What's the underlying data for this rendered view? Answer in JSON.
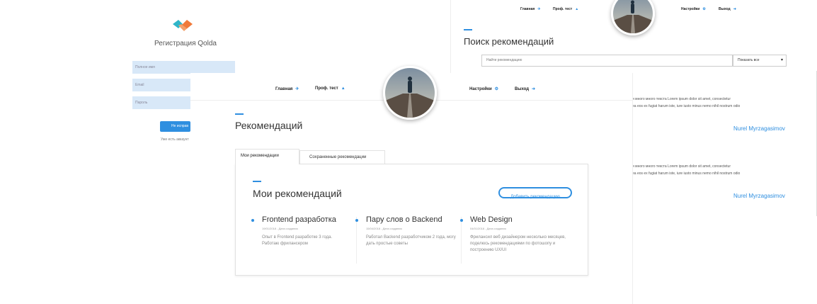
{
  "registration": {
    "title": "Регистрация Qolda",
    "fields": [
      "Полное имя",
      "Email",
      "Пароль"
    ],
    "submit_label": "Не исправ",
    "footer_text": "Уже есть аккаунт"
  },
  "search_window": {
    "nav": {
      "home": "Главная",
      "test": "Проф. тест",
      "settings": "Настройки",
      "logout": "Выход"
    },
    "title": "Поиск рекомендаций",
    "search_placeholder": "Найти рекомендацию",
    "filter_value": "Показать все",
    "results": [
      {
        "line1": "и много много текста Lorem ipsum dolor sit amet, consectetur",
        "line2": "ea eos ex fugiat harum iste, iure iusto minus nemo nihil nostrum odio",
        "author": "Nurel Myrzagasimov"
      },
      {
        "line1": "и много много текста Lorem ipsum dolor sit amet, consectetur",
        "line2": "ea eos ex fugiat harum iste, iure iusto minus nemo nihil nostrum odio",
        "author": "Nurel Myrzagasimov"
      }
    ]
  },
  "main_window": {
    "nav": {
      "home": "Главная",
      "test": "Проф. тест",
      "settings": "Настройки",
      "logout": "Выход"
    },
    "page_title": "Рекомендаций",
    "tabs": [
      "Мои рекомендации",
      "Сохраненные рекомендации"
    ],
    "section_title": "Мои рекомендаций",
    "add_button": "Добавить рекомендацию",
    "cards": [
      {
        "title": "Frontend разработка",
        "date": "19/01/2018 - Дата создания",
        "desc": "Опыт в Frontend разработке 3 года. Работаю фрилансером"
      },
      {
        "title": "Пару слов о Backend",
        "date": "15/04/2018 - Дата создания",
        "desc": "Работал Backend разработчиком 2 года, могу дать простые советы"
      },
      {
        "title": "Web Design",
        "date": "04/01/2018 - Дата создания",
        "desc": "Фрилансил веб дизайнером несколько месяцев, поделюсь рекомендациями по фотошопу и построению UX/UI"
      }
    ]
  },
  "colors": {
    "accent": "#2f8fe0",
    "input_bg": "#d8e8f8"
  }
}
